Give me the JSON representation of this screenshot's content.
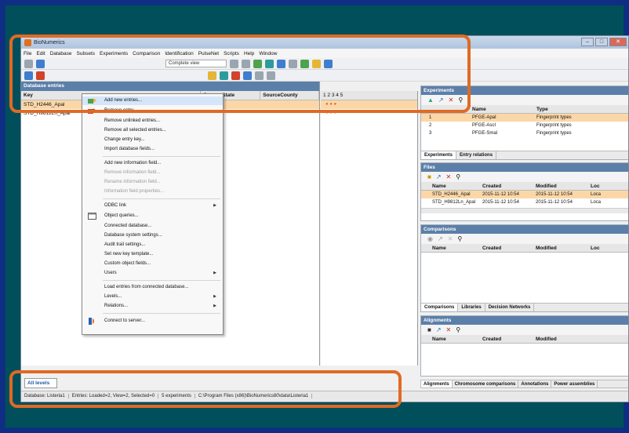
{
  "window": {
    "title": "BioNumerics",
    "btn_min": "–",
    "btn_max": "□",
    "btn_close": "✕"
  },
  "menubar": [
    "File",
    "Edit",
    "Database",
    "Subsets",
    "Experiments",
    "Comparison",
    "Identification",
    "PulseNet",
    "Scripts",
    "Help",
    "Window"
  ],
  "toolbar": {
    "complete_view": "Complete view"
  },
  "database": {
    "title": "Database entries",
    "columns": [
      "Key",
      "Source State",
      "SourceCounty"
    ],
    "rows": [
      "STD_H2446_Apal",
      "STD_H9812Ln_Apal"
    ],
    "fp_header": "1  2  3  4  5"
  },
  "context_menu": {
    "items": [
      {
        "label": "Add new entries...",
        "state": "hover"
      },
      {
        "label": "Remove entry...",
        "state": "normal"
      },
      {
        "label": "Remove unlinked entries...",
        "state": "normal"
      },
      {
        "label": "Remove all selected entries...",
        "state": "normal"
      },
      {
        "label": "Change entry key...",
        "state": "normal"
      },
      {
        "label": "Import database fields...",
        "state": "normal"
      },
      {
        "label": "Add new information field...",
        "state": "normal"
      },
      {
        "label": "Remove information field...",
        "state": "disabled"
      },
      {
        "label": "Rename information field...",
        "state": "disabled"
      },
      {
        "label": "Information field properties...",
        "state": "disabled"
      },
      {
        "label": "ODBC link",
        "state": "submenu"
      },
      {
        "label": "Object queries...",
        "state": "normal"
      },
      {
        "label": "Connected database...",
        "state": "normal"
      },
      {
        "label": "Database system settings...",
        "state": "normal"
      },
      {
        "label": "Audit trail settings...",
        "state": "normal"
      },
      {
        "label": "Set new key template...",
        "state": "normal"
      },
      {
        "label": "Custom object fields...",
        "state": "normal"
      },
      {
        "label": "Users",
        "state": "submenu"
      },
      {
        "label": "Load entries from connected database...",
        "state": "normal"
      },
      {
        "label": "Levels...",
        "state": "submenu"
      },
      {
        "label": "Relations...",
        "state": "submenu"
      },
      {
        "label": "Connect to server...",
        "state": "normal"
      }
    ]
  },
  "experiments": {
    "title": "Experiments",
    "columns": [
      "Name",
      "Type"
    ],
    "rows": [
      {
        "n": "1",
        "name": "PFGE-ApaI",
        "type": "Fingerprint types"
      },
      {
        "n": "2",
        "name": "PFGE-AscI",
        "type": "Fingerprint types"
      },
      {
        "n": "3",
        "name": "PFGE-SmaI",
        "type": "Fingerprint types"
      }
    ],
    "tabs": [
      "Experiments",
      "Entry relations"
    ]
  },
  "files": {
    "title": "Files",
    "columns": [
      "Name",
      "Created",
      "Modified",
      "Loc"
    ],
    "rows": [
      {
        "name": "STD_H2446_ApaI",
        "created": "2015-11-12 10:54",
        "modified": "2015-11-12 10:54",
        "loc": "Loca"
      },
      {
        "name": "STD_H9812Ln_ApaI",
        "created": "2015-11-12 10:54",
        "modified": "2015-11-12 10:54",
        "loc": "Loca"
      }
    ]
  },
  "comparisons": {
    "title": "Comparisons",
    "columns": [
      "Name",
      "Created",
      "Modified",
      "Loc"
    ],
    "tabs": [
      "Comparisons",
      "Libraries",
      "Decision Networks"
    ]
  },
  "alignments": {
    "title": "Alignments",
    "columns": [
      "Name",
      "Created",
      "Modified"
    ]
  },
  "bottom_tabs": [
    "Alignments",
    "Chromosome comparisons",
    "Annotations",
    "Power assemblies"
  ],
  "level_tab": "All levels",
  "statusbar": [
    "Database: Listeria1",
    "Entries: Loaded=2, View=2, Selected=0",
    "5 experiments",
    "C:\\Program Files (x86)\\BioNumerics80\\data\\Listeria1"
  ],
  "colors": {
    "highlight": "#e06a24",
    "slide_bg": "#004f5b",
    "frame": "#0f2d84"
  }
}
